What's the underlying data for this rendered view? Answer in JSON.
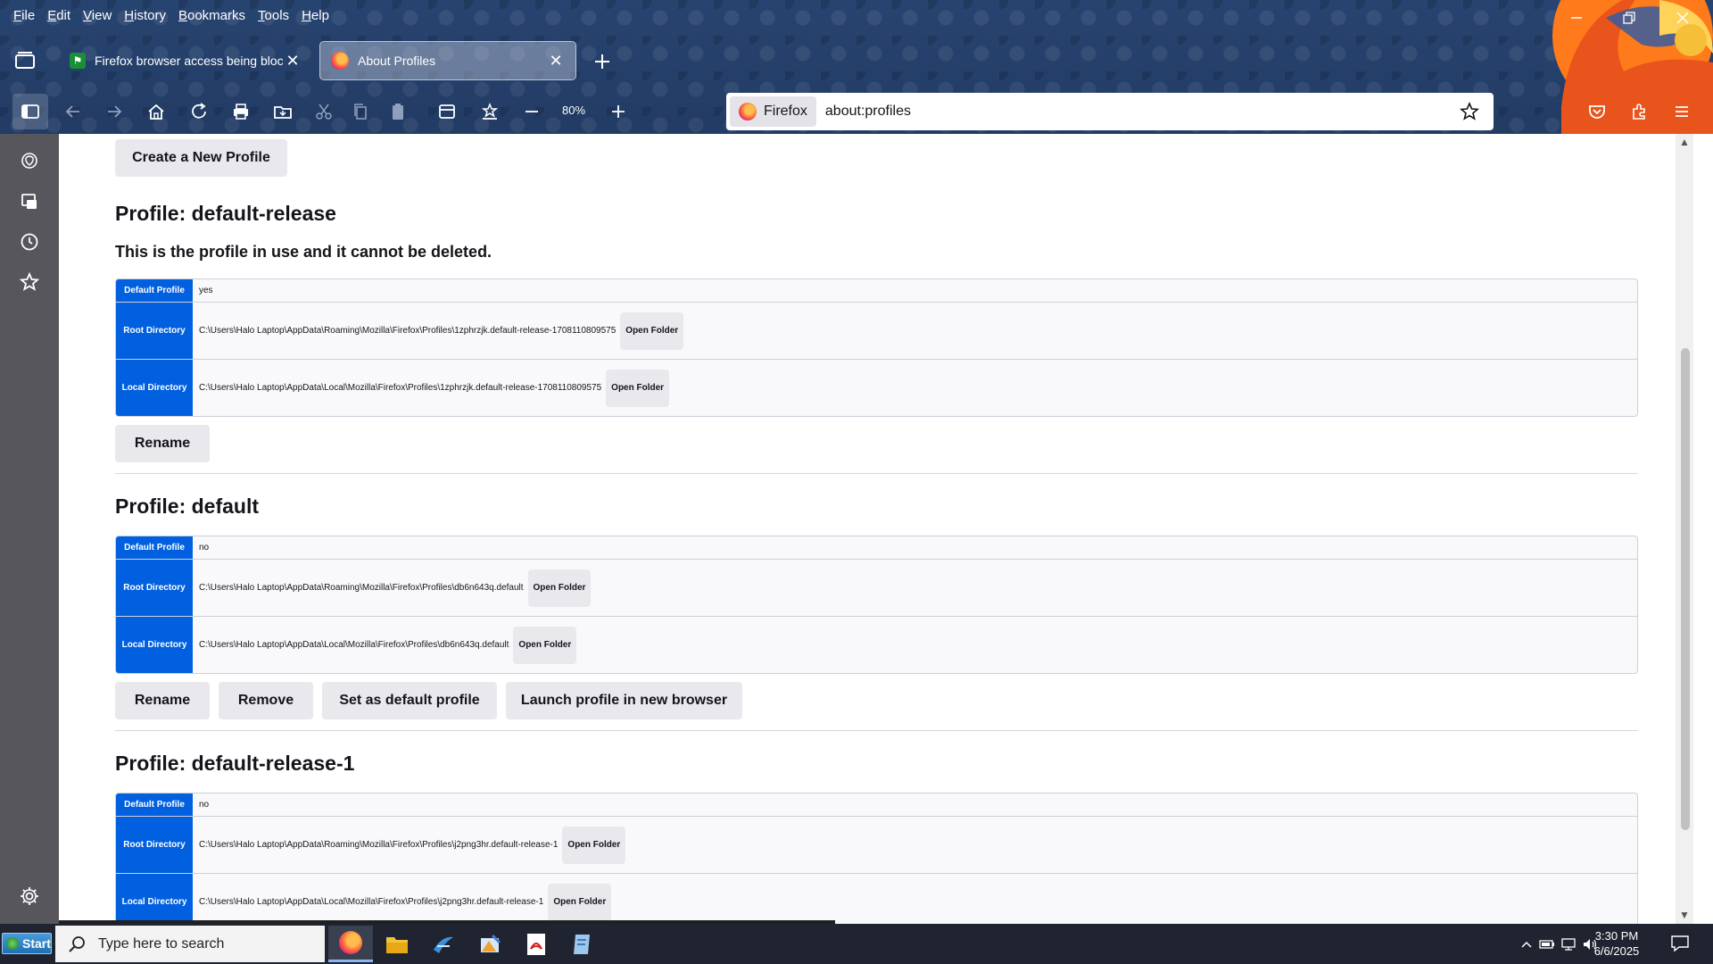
{
  "menubar": {
    "items": [
      "File",
      "Edit",
      "View",
      "History",
      "Bookmarks",
      "Tools",
      "Help"
    ]
  },
  "tabs": [
    {
      "title": "Firefox browser access being blocked |",
      "favicon": "green-site-icon"
    },
    {
      "title": "About Profiles",
      "favicon": "firefox-logo-icon"
    }
  ],
  "toolbar": {
    "zoom": "80%"
  },
  "urlbar": {
    "identity_label": "Firefox",
    "url": "about:profiles"
  },
  "page": {
    "create_button": "Create a New Profile",
    "labels": {
      "default_profile": "Default Profile",
      "root_directory": "Root Directory",
      "local_directory": "Local Directory",
      "open_folder": "Open Folder"
    },
    "profiles": [
      {
        "title": "Profile: default-release",
        "note": "This is the profile in use and it cannot be deleted.",
        "is_default": "yes",
        "root_dir": "C:\\Users\\Halo Laptop\\AppData\\Roaming\\Mozilla\\Firefox\\Profiles\\1zphrzjk.default-release-1708110809575",
        "local_dir": "C:\\Users\\Halo Laptop\\AppData\\Local\\Mozilla\\Firefox\\Profiles\\1zphrzjk.default-release-1708110809575",
        "actions": [
          "Rename"
        ]
      },
      {
        "title": "Profile: default",
        "is_default": "no",
        "root_dir": "C:\\Users\\Halo Laptop\\AppData\\Roaming\\Mozilla\\Firefox\\Profiles\\db6n643q.default",
        "local_dir": "C:\\Users\\Halo Laptop\\AppData\\Local\\Mozilla\\Firefox\\Profiles\\db6n643q.default",
        "actions": [
          "Rename",
          "Remove",
          "Set as default profile",
          "Launch profile in new browser"
        ]
      },
      {
        "title": "Profile: default-release-1",
        "is_default": "no",
        "root_dir": "C:\\Users\\Halo Laptop\\AppData\\Roaming\\Mozilla\\Firefox\\Profiles\\j2png3hr.default-release-1",
        "local_dir": "C:\\Users\\Halo Laptop\\AppData\\Local\\Mozilla\\Firefox\\Profiles\\j2png3hr.default-release-1"
      }
    ]
  },
  "taskbar": {
    "start_label": "Start",
    "search_placeholder": "Type here to search",
    "time": "3:30 PM",
    "date": "6/6/2025"
  },
  "colors": {
    "accent": "#0060df",
    "sidebar": "#56565c",
    "taskbar": "#1f2430"
  }
}
